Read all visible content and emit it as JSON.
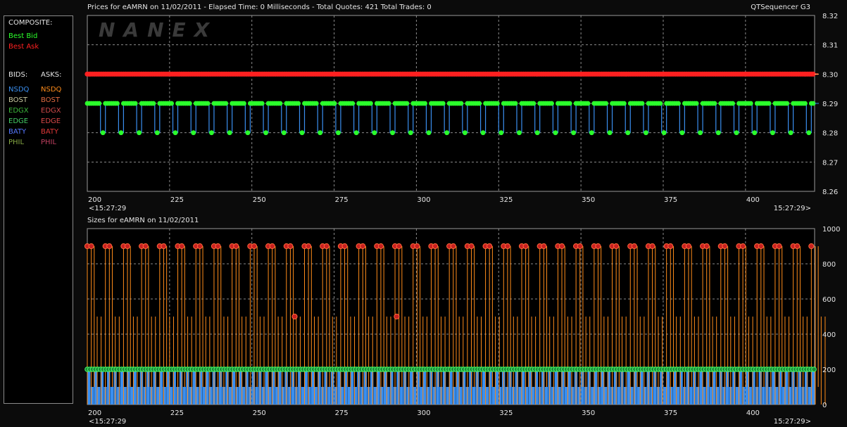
{
  "header": {
    "price_title": "Prices for  eAMRN  on  11/02/2011  -  Elapsed Time: 0 Milliseconds  -  Total Quotes: 421  Total Trades: 0",
    "app_name": "QTSequencer G3",
    "size_title": "Sizes for  eAMRN  on  11/02/2011"
  },
  "watermark": "NANEX",
  "legend": {
    "composite_label": "COMPOSITE:",
    "best_bid": "Best Bid",
    "best_ask": "Best Ask",
    "bids_label": "BIDS:",
    "asks_label": "ASKS:",
    "exchanges": [
      "NSDQ",
      "BOST",
      "EDGX",
      "EDGE",
      "BATY",
      "PHIL"
    ]
  },
  "colors": {
    "best_bid": "#2bff2b",
    "best_ask": "#ff2020",
    "nsdq_bid": "#3a8ff0",
    "bost_bid": "#c8c8a0",
    "edgx_bid": "#3cb83c",
    "edge_bid": "#44cc66",
    "baty_bid": "#5577ff",
    "phil_bid": "#88aa44",
    "nsdq_ask": "#ff8c1a",
    "bost_ask": "#e06a40",
    "edgx_ask": "#d04a4a",
    "edge_ask": "#d84848",
    "baty_ask": "#e03838",
    "phil_ask": "#c04060"
  },
  "chart_data": [
    {
      "type": "line",
      "x_ticks": [
        200,
        225,
        250,
        275,
        300,
        325,
        350,
        375,
        400
      ],
      "xlim": [
        200,
        421
      ],
      "time_start": "<15:27:29",
      "time_end": "15:27:29>",
      "ylim": [
        8.26,
        8.32
      ],
      "y_ticks": [
        "8.32",
        "8.31",
        "8.30",
        "8.29",
        "8.28",
        "8.27",
        "8.26"
      ],
      "grid": true,
      "series": [
        {
          "name": "Best Ask",
          "pattern": "constant",
          "value": 8.3
        },
        {
          "name": "Best Bid",
          "pattern": "alternating",
          "values": [
            8.29,
            8.28
          ]
        }
      ]
    },
    {
      "type": "line",
      "x_ticks": [
        200,
        225,
        250,
        275,
        300,
        325,
        350,
        375,
        400
      ],
      "xlim": [
        200,
        421
      ],
      "time_start": "<15:27:29",
      "time_end": "15:27:29>",
      "ylim": [
        0,
        1000
      ],
      "y_ticks": [
        "1000",
        "800",
        "600",
        "400",
        "200",
        "0"
      ],
      "grid": true,
      "series": [
        {
          "name": "Best Ask",
          "pattern": "alternating",
          "values": [
            900,
            500
          ],
          "anomalies": [
            [
              263,
              500
            ],
            [
              294,
              500
            ]
          ]
        },
        {
          "name": "Best Bid",
          "pattern": "constant",
          "value": 200
        },
        {
          "name": "NSDQ Bid",
          "pattern": "alternating",
          "values": [
            200,
            100
          ]
        }
      ]
    }
  ]
}
